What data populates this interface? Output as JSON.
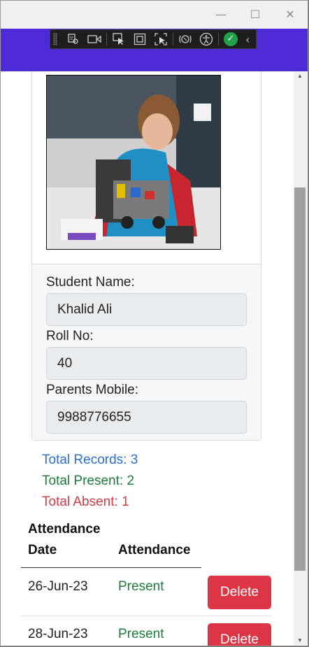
{
  "window_controls": {
    "minimize": "—",
    "maximize": "☐",
    "close": "✕"
  },
  "devtools_toolbar": {
    "icons": [
      "grip-icon",
      "live-visual-tree-icon",
      "video-icon",
      "select-element-icon",
      "display-layout-adorners-icon",
      "track-focus-icon",
      "binding-failures-icon",
      "accessibility-icon",
      "status-check-icon",
      "collapse-chevron-icon"
    ]
  },
  "student": {
    "name_label": "Student Name:",
    "name_value": "Khalid Ali",
    "roll_label": "Roll No:",
    "roll_value": "40",
    "mobile_label": "Parents Mobile:",
    "mobile_value": "9988776655"
  },
  "stats": {
    "total_records": "Total Records: 3",
    "total_present": "Total Present: 2",
    "total_absent": "Total Absent: 1"
  },
  "colors": {
    "app_bar": "#4f2bd8",
    "records": "#2c6fd1",
    "present": "#1e7a3d",
    "absent": "#d33a46",
    "delete_button": "#dc3545"
  },
  "table": {
    "headers": {
      "date_line1": "Attendance",
      "date_line2": "Date",
      "attendance": "Attendance"
    },
    "rows": [
      {
        "date": "26-Jun-23",
        "status": "Present",
        "action": "Delete"
      },
      {
        "date": "28-Jun-23",
        "status": "Present",
        "action": "Delete"
      }
    ]
  }
}
